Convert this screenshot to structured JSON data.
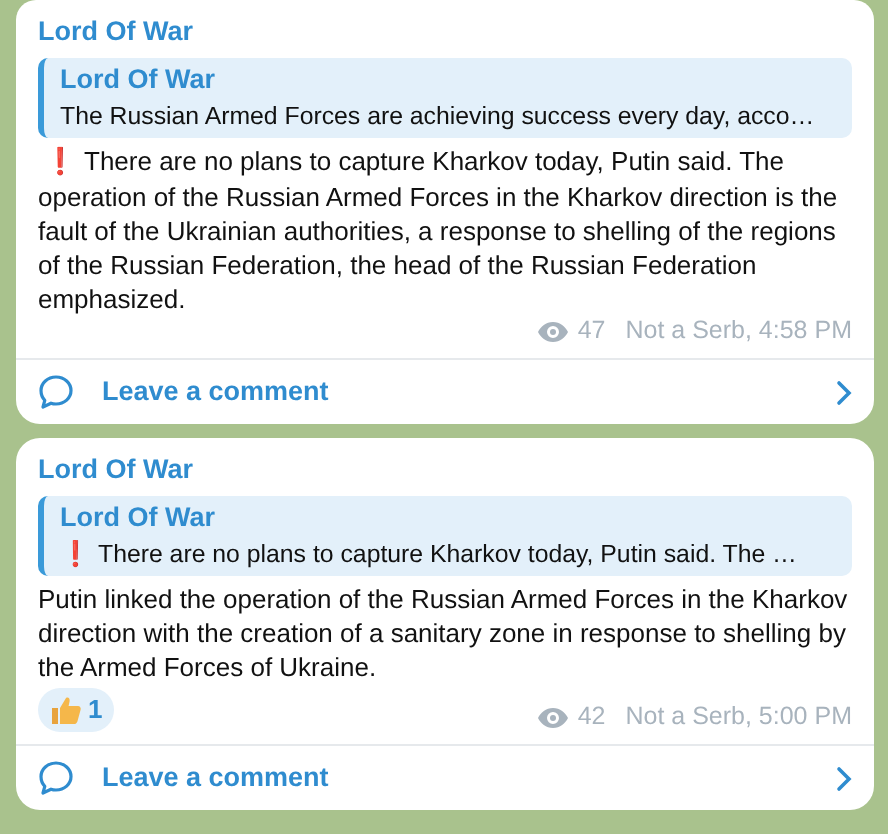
{
  "messages": [
    {
      "sender": "Lord Of War",
      "reply": {
        "sender": "Lord Of War",
        "text": "The Russian Armed Forces are achieving success every day, acco…"
      },
      "mark": "❗",
      "text": "There are no plans to capture Kharkov today, Putin said. The operation of the Russian Armed Forces in the Kharkov direction is the fault of the Ukrainian authorities, a response to shelling of the regions of the Russian Federation, the head of the Russian Federation emphasized.",
      "views": "47",
      "signature": "Not a Serb, 4:58 PM",
      "comment": "Leave a comment"
    },
    {
      "sender": "Lord Of War",
      "reply": {
        "sender": "Lord Of War",
        "mark": "❗",
        "text": "There are no plans to capture Kharkov today, Putin said. The …"
      },
      "text": "Putin linked the operation of the Russian Armed Forces in the Kharkov direction with the creation of a sanitary zone in response to shelling by the Armed Forces of Ukraine.",
      "reactions": [
        {
          "kind": "thumbs_up",
          "count": "1"
        }
      ],
      "views": "42",
      "signature": "Not a Serb, 5:00 PM",
      "comment": "Leave a comment"
    }
  ]
}
